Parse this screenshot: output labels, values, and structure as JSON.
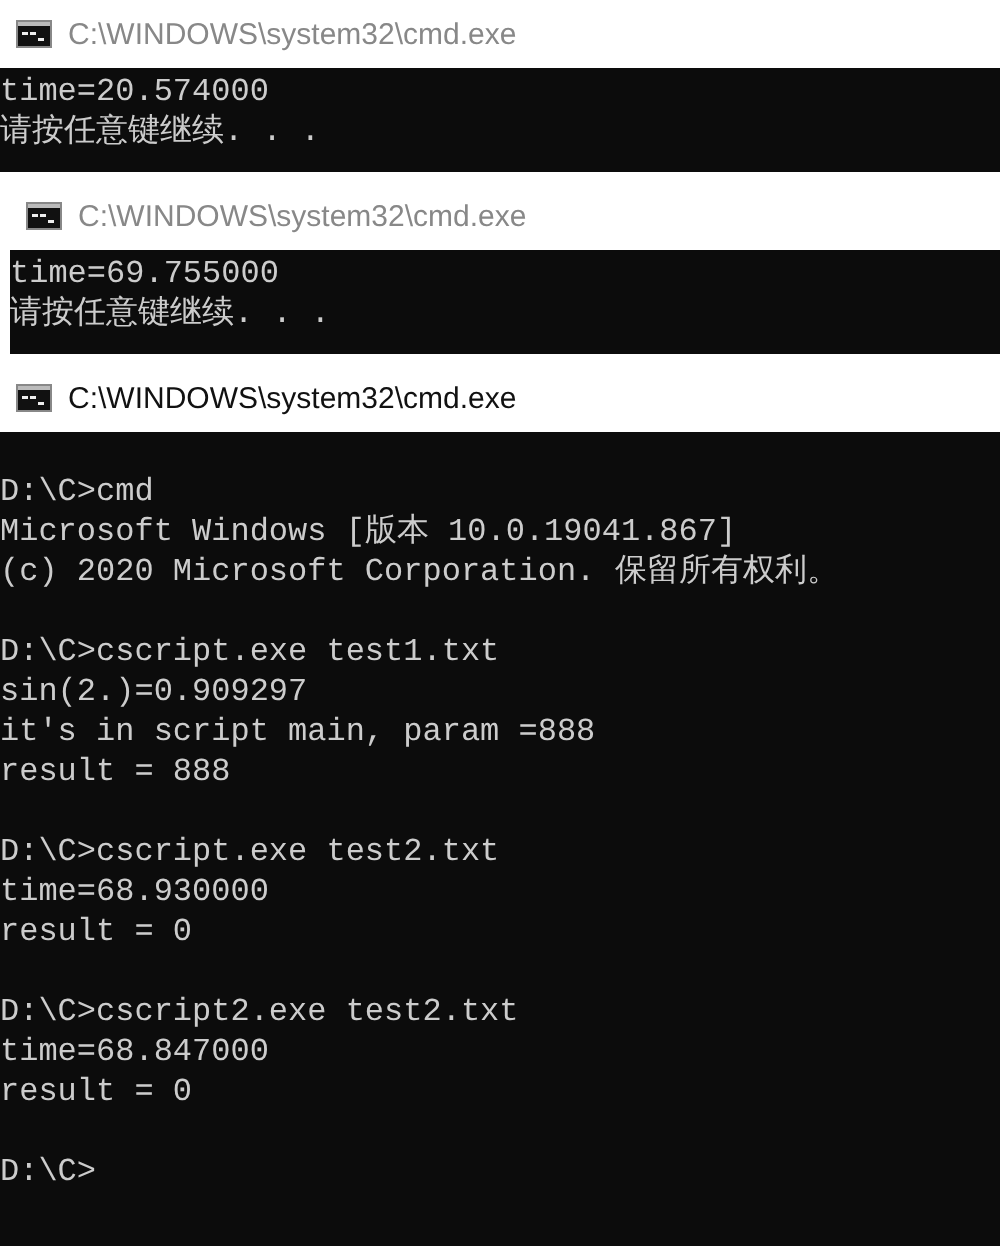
{
  "windows": [
    {
      "title": "C:\\WINDOWS\\system32\\cmd.exe",
      "active": false,
      "blocks": [
        [
          "time=20.574000",
          "请按任意键继续. . ."
        ]
      ]
    },
    {
      "title": "C:\\WINDOWS\\system32\\cmd.exe",
      "active": false,
      "blocks": [
        [
          "time=69.755000",
          "请按任意键继续. . ."
        ]
      ]
    },
    {
      "title": "C:\\WINDOWS\\system32\\cmd.exe",
      "active": true,
      "blocks": [
        [
          "D:\\C>cmd",
          "Microsoft Windows [版本 10.0.19041.867]",
          "(c) 2020 Microsoft Corporation. 保留所有权利。"
        ],
        [
          "D:\\C>cscript.exe test1.txt",
          "sin(2.)=0.909297",
          "it's in script main, param =888",
          "result = 888"
        ],
        [
          "D:\\C>cscript.exe test2.txt",
          "time=68.930000",
          "result = 0"
        ],
        [
          "D:\\C>cscript2.exe test2.txt",
          "time=68.847000",
          "result = 0"
        ],
        [
          "D:\\C>"
        ]
      ]
    }
  ]
}
